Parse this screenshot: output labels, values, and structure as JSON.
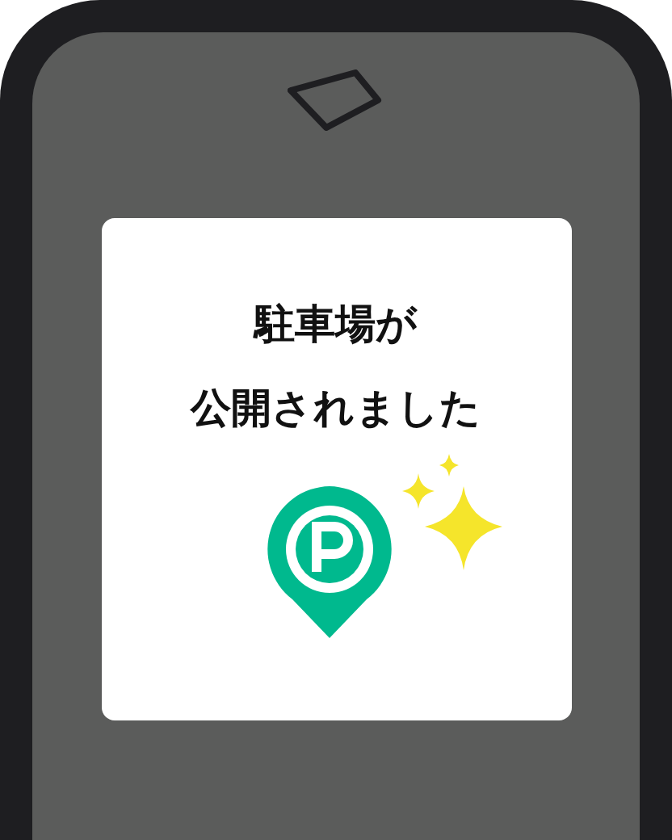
{
  "dialog": {
    "title_lines": [
      "駐車場が",
      "公開されました"
    ]
  }
}
